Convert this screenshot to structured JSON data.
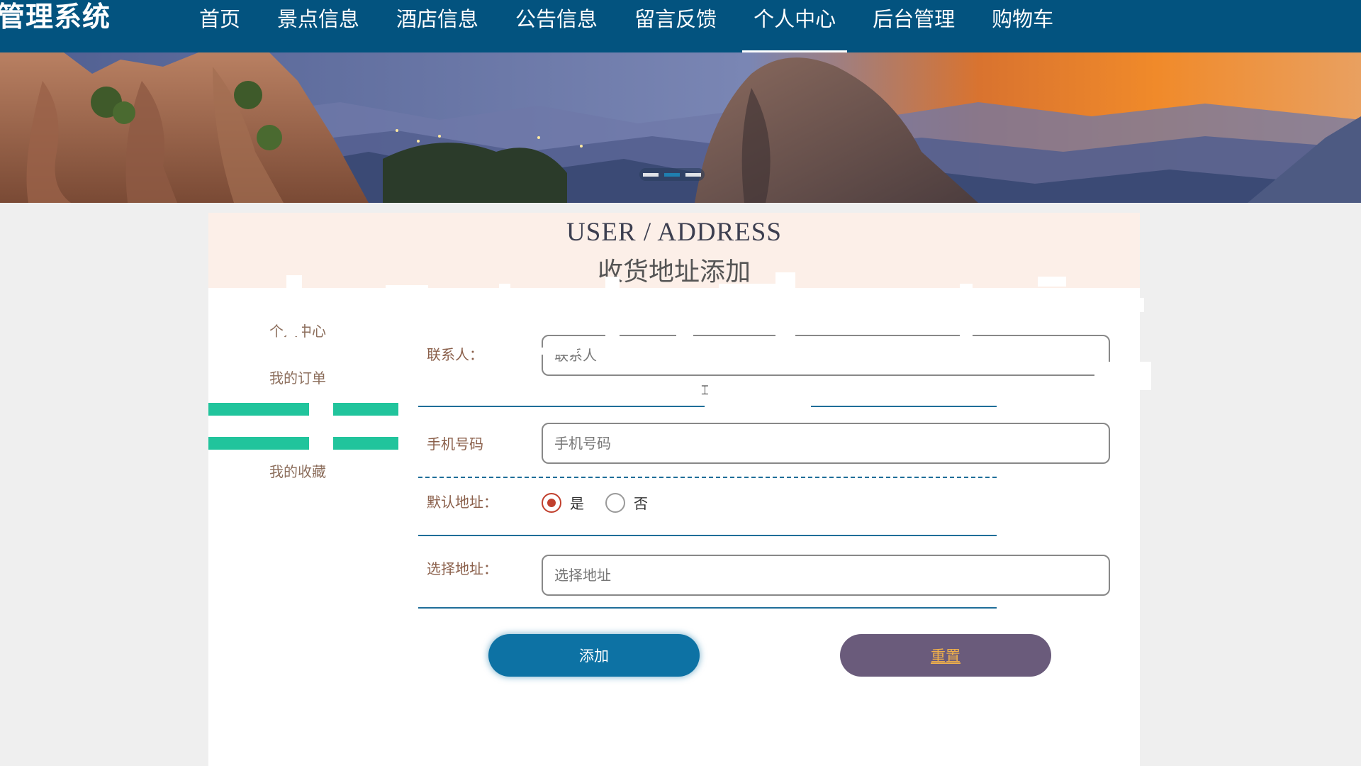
{
  "header": {
    "site_title": "息管理系统",
    "nav": [
      {
        "label": "首页"
      },
      {
        "label": "景点信息"
      },
      {
        "label": "酒店信息"
      },
      {
        "label": "公告信息"
      },
      {
        "label": "留言反馈"
      },
      {
        "label": "个人中心",
        "active": true
      },
      {
        "label": "后台管理"
      },
      {
        "label": "购物车"
      }
    ]
  },
  "banner": {
    "slides_count": 3,
    "active_slide": 2
  },
  "panel": {
    "title_en": "USER / ADDRESS",
    "title_cn": "收货地址添加",
    "side_menu": [
      {
        "label": "个人中心"
      },
      {
        "label": "我的订单"
      },
      {
        "label": "我的收藏"
      }
    ],
    "form": {
      "contact": {
        "label": "联系人：",
        "placeholder": "联系人",
        "value": ""
      },
      "phone": {
        "label": "手机号码",
        "placeholder": "手机号码",
        "value": ""
      },
      "default_address": {
        "label": "默认地址：",
        "options": [
          {
            "label": "是",
            "checked": true
          },
          {
            "label": "否",
            "checked": false
          }
        ]
      },
      "address": {
        "label": "选择地址：",
        "placeholder": "选择地址",
        "value": ""
      }
    },
    "buttons": {
      "add_label": "添加",
      "reset_label": "重置"
    }
  },
  "colors": {
    "nav_bg": "#03537f",
    "accent_blue": "#0d72a4",
    "reset_bg": "#6a5b7b",
    "reset_text": "#f0b04a",
    "radio_checked": "#c1402e",
    "panel_head_bg": "#fcefe8",
    "side_accent": "#21c49c"
  }
}
